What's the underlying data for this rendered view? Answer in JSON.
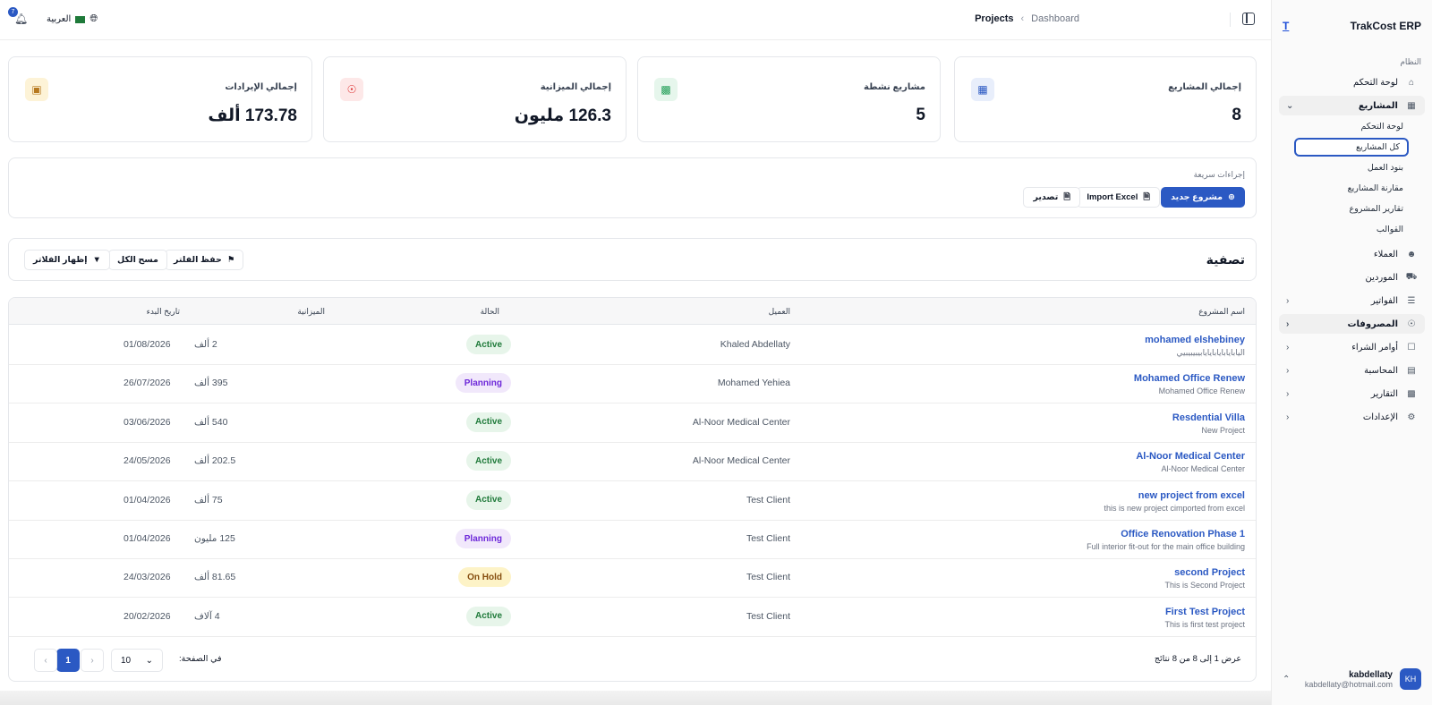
{
  "app": {
    "name": "TrakCost ERP",
    "logo_letter": "T"
  },
  "topbar": {
    "notifications_count": "7",
    "language": "العربية",
    "breadcrumb": {
      "parent": "Dashboard",
      "current": "Projects"
    }
  },
  "sidebar": {
    "section_label": "النظام",
    "items": [
      {
        "label": "لوحة التحكم",
        "icon": "home-icon"
      },
      {
        "label": "المشاريع",
        "icon": "building-icon"
      },
      {
        "label": "العملاء",
        "icon": "users-icon"
      },
      {
        "label": "الموردين",
        "icon": "truck-icon"
      },
      {
        "label": "الفواتير",
        "icon": "invoice-icon"
      },
      {
        "label": "المصروفات",
        "icon": "dollar-icon"
      },
      {
        "label": "أوامر الشراء",
        "icon": "clipboard-icon"
      },
      {
        "label": "المحاسبة",
        "icon": "ledger-icon"
      },
      {
        "label": "التقارير",
        "icon": "chart-icon"
      },
      {
        "label": "الإعدادات",
        "icon": "gear-icon"
      }
    ],
    "projects_sub": [
      "لوحة التحكم",
      "كل المشاريع",
      "بنود العمل",
      "مقارنة المشاريع",
      "تقارير المشروع",
      "القوالب"
    ]
  },
  "user": {
    "name": "kabdellaty",
    "email": "kabdellaty@hotmail.com",
    "initials": "KH"
  },
  "stats": [
    {
      "label": "إجمالي المشاريع",
      "value": "8",
      "icon": "building-icon",
      "color": "#2b59c3",
      "bg": "#e8eefb"
    },
    {
      "label": "مشاريع نشطة",
      "value": "5",
      "icon": "chart-icon",
      "color": "#1f9d55",
      "bg": "#e6f6ec"
    },
    {
      "label": "إجمالي الميزانية",
      "value": "126.3 مليون",
      "icon": "dollar-icon",
      "color": "#dc2626",
      "bg": "#fde8e8"
    },
    {
      "label": "إجمالي الإيرادات",
      "value": "173.78 ألف",
      "icon": "cash-icon",
      "color": "#b7791f",
      "bg": "#fdf3d7"
    }
  ],
  "quick_actions": {
    "title": "إجراءات سريعة",
    "new_project": "مشروع جديد",
    "import_excel": "Import Excel",
    "export": "تصدير"
  },
  "filter": {
    "title": "تصفية",
    "save": "حفظ الفلتر",
    "clear": "مسح الكل",
    "show": "إظهار الفلاتر"
  },
  "table": {
    "headers": {
      "name": "اسم المشروع",
      "client": "العميل",
      "status": "الحالة",
      "budget": "الميزانية",
      "start": "تاريخ البدء"
    },
    "rows": [
      {
        "name": "mohamed elshebiney",
        "desc": "اليابايابايابايايابيبيبيبيي",
        "client": "Khaled Abdellaty",
        "status": "Active",
        "budget": "2 ألف",
        "start": "01/08/2026"
      },
      {
        "name": "Mohamed Office Renew",
        "desc": "Mohamed Office Renew",
        "client": "Mohamed Yehiea",
        "status": "Planning",
        "budget": "395 ألف",
        "start": "26/07/2026"
      },
      {
        "name": "Resdential Villa",
        "desc": "New Project",
        "client": "Al-Noor Medical Center",
        "status": "Active",
        "budget": "540 ألف",
        "start": "03/06/2026"
      },
      {
        "name": "Al-Noor Medical Center",
        "desc": "Al-Noor Medical Center",
        "client": "Al-Noor Medical Center",
        "status": "Active",
        "budget": "202.5 ألف",
        "start": "24/05/2026"
      },
      {
        "name": "new project from excel",
        "desc": "this is new project cimported from excel",
        "client": "Test Client",
        "status": "Active",
        "budget": "75 ألف",
        "start": "01/04/2026"
      },
      {
        "name": "Office Renovation Phase 1",
        "desc": "Full interior fit-out for the main office building",
        "client": "Test Client",
        "status": "Planning",
        "budget": "125 مليون",
        "start": "01/04/2026"
      },
      {
        "name": "second Project",
        "desc": "This is Second Project",
        "client": "Test Client",
        "status": "On Hold",
        "budget": "81.65 ألف",
        "start": "24/03/2026"
      },
      {
        "name": "First Test Project",
        "desc": "This is first test project",
        "client": "Test Client",
        "status": "Active",
        "budget": "4 آلاف",
        "start": "20/02/2026"
      }
    ]
  },
  "pagination": {
    "info": "عرض 1 إلى 8 من 8 نتائج",
    "per_page_label": "في الصفحة:",
    "per_page_value": "10",
    "current_page": "1"
  }
}
